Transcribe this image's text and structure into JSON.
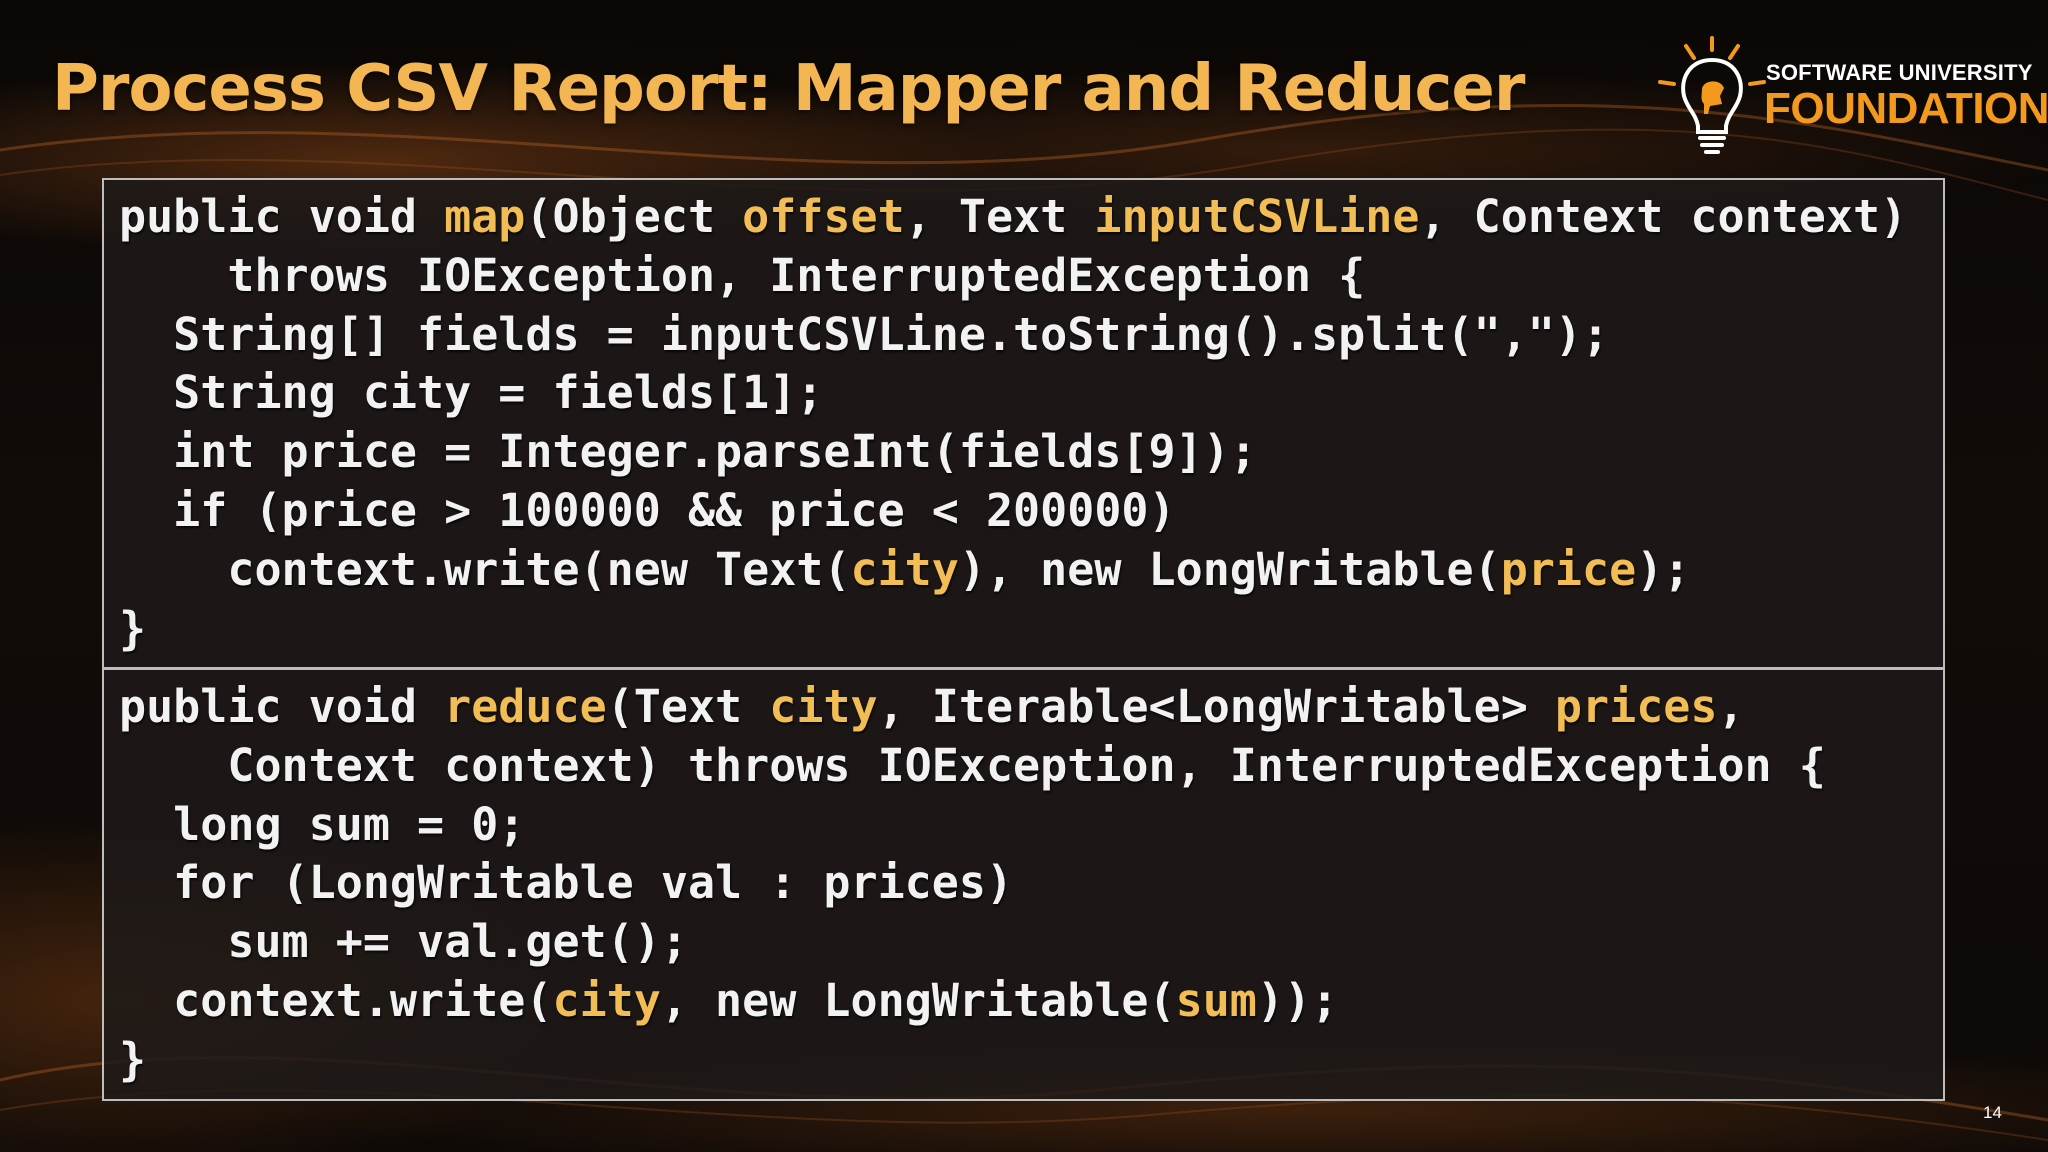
{
  "slide": {
    "title": "Process CSV Report: Mapper and Reducer",
    "page_number": "14",
    "colors": {
      "title": "#f3b653",
      "highlight": "#f3bd55",
      "code_text": "#f2f2f2",
      "panel_border": "#bdbdbd",
      "logo_accent": "#f39a1e"
    }
  },
  "logo": {
    "line1": "SOFTWARE UNIVERSITY",
    "line2": "FOUNDATION",
    "icon": "lightbulb-head-icon"
  },
  "map_code": {
    "l1": {
      "a": "public void ",
      "b": "map",
      "c": "(Object ",
      "d": "offset",
      "e": ", Text ",
      "f": "inputCSVLine",
      "g": ", Context context)"
    },
    "l2": "    throws IOException, InterruptedException {",
    "l3": "  String[] fields = inputCSVLine.toString().split(\",\");",
    "l4": "  String city = fields[1];",
    "l5": "  int price = Integer.parseInt(fields[9]);",
    "l6": "  if (price > 100000 && price < 200000)",
    "l7": {
      "a": "    context.write(new Text(",
      "b": "city",
      "c": "), new LongWritable(",
      "d": "price",
      "e": ");"
    },
    "l8": "}"
  },
  "reduce_code": {
    "l1": {
      "a": "public void ",
      "b": "reduce",
      "c": "(Text ",
      "d": "city",
      "e": ", Iterable<LongWritable> ",
      "f": "prices",
      "g": ","
    },
    "l2": "    Context context) throws IOException, InterruptedException {",
    "l3": "  long sum = 0;",
    "l4": "  for (LongWritable val : prices)",
    "l5": "    sum += val.get();",
    "l6": {
      "a": "  context.write(",
      "b": "city",
      "c": ", new LongWritable(",
      "d": "sum",
      "e": "));"
    },
    "l7": "}"
  }
}
